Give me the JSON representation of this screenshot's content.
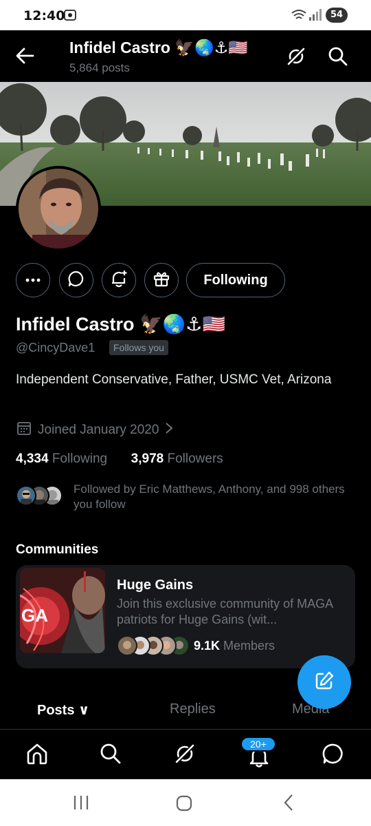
{
  "status_bar": {
    "time": "12:40",
    "battery": "54"
  },
  "header": {
    "title": "Infidel Castro 🦅🌏⚓🇺🇸",
    "posts_count": "5,864 posts"
  },
  "profile": {
    "actions": {
      "following_label": "Following"
    },
    "name": "Infidel Castro 🦅🌏⚓🇺🇸",
    "handle": "@CincyDave1",
    "follows_you": "Follows you",
    "bio": "Independent Conservative, Father, USMC Vet, Arizona",
    "joined": "Joined January 2020",
    "following_count": "4,334",
    "following_label": "Following",
    "followers_count": "3,978",
    "followers_label": "Followers",
    "followed_by": "Followed by Eric Matthews, Anthony, and 998 others you follow"
  },
  "communities": {
    "title": "Communities",
    "card": {
      "name": "Huge Gains",
      "description": "Join this exclusive community of MAGA patriots for Huge Gains (wit...",
      "members_count": "9.1K",
      "members_label": "Members",
      "image_text": "GA"
    }
  },
  "tabs": [
    {
      "label": "Posts ∨"
    },
    {
      "label": "Replies"
    },
    {
      "label": "Media"
    }
  ],
  "bottom_nav": {
    "notifications_badge": "20+"
  },
  "colors": {
    "accent": "#1d9bf0",
    "background": "#000000",
    "secondary_text": "#71767b"
  }
}
